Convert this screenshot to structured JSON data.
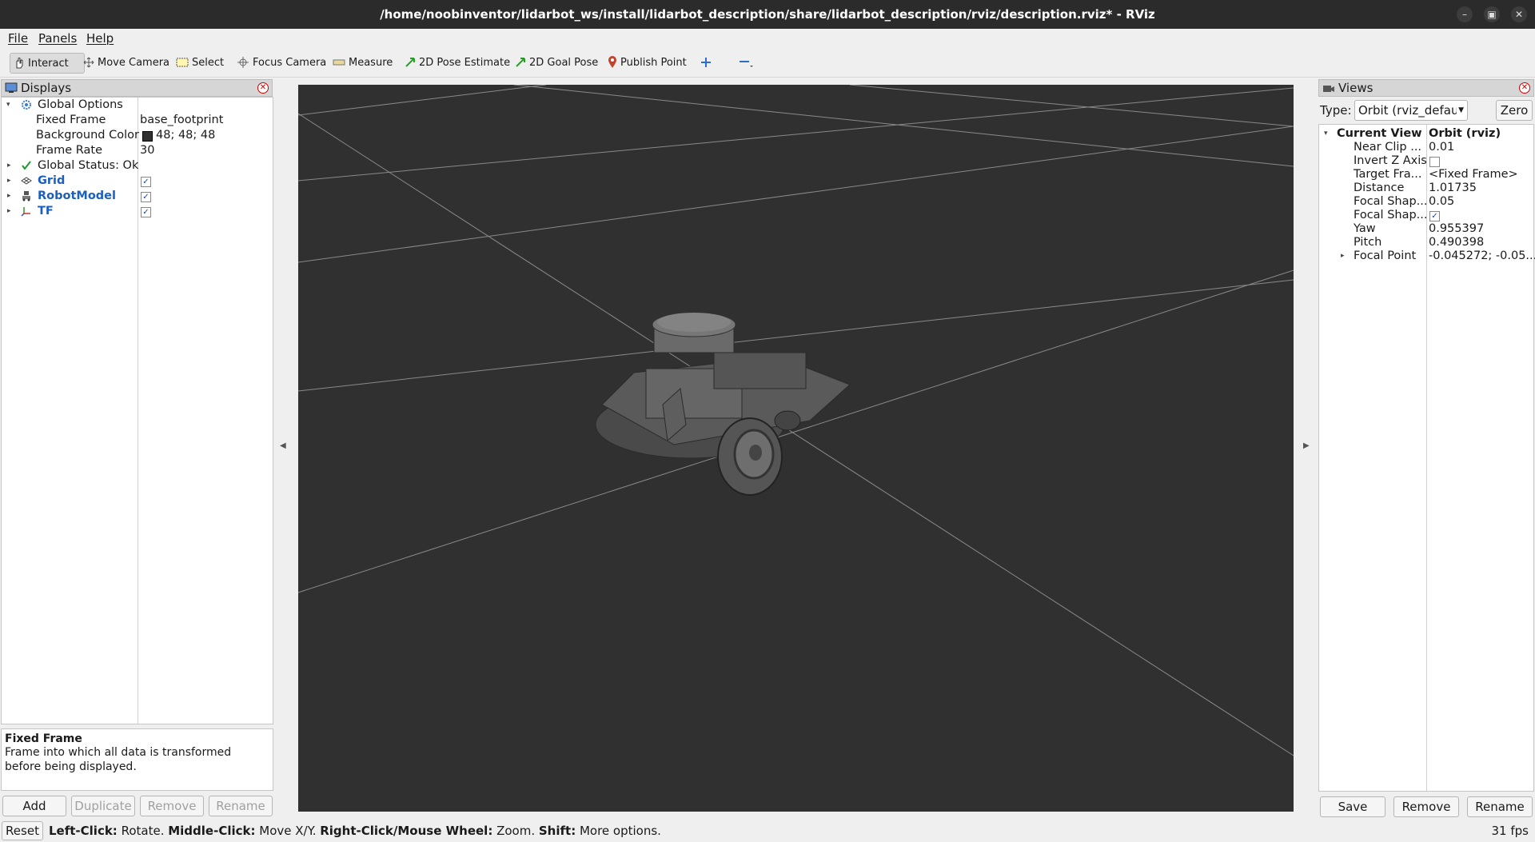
{
  "window": {
    "title": "/home/noobinventor/lidarbot_ws/install/lidarbot_description/share/lidarbot_description/rviz/description.rviz* - RViz"
  },
  "menu": [
    "File",
    "Panels",
    "Help"
  ],
  "toolbar": {
    "interact": "Interact",
    "move_camera": "Move Camera",
    "select": "Select",
    "focus_camera": "Focus Camera",
    "measure": "Measure",
    "pose_estimate": "2D Pose Estimate",
    "goal_pose": "2D Goal Pose",
    "publish_point": "Publish Point"
  },
  "displays": {
    "title": "Displays",
    "global_options": "Global Options",
    "fixed_frame_label": "Fixed Frame",
    "fixed_frame_value": "base_footprint",
    "bg_color_label": "Background Color",
    "bg_color_value": "48; 48; 48",
    "bg_color_swatch": "#303030",
    "frame_rate_label": "Frame Rate",
    "frame_rate_value": "30",
    "global_status": "Global Status: Ok",
    "grid": "Grid",
    "robot_model": "RobotModel",
    "tf": "TF",
    "desc_title": "Fixed Frame",
    "desc_text": "Frame into which all data is transformed before being displayed.",
    "buttons": {
      "add": "Add",
      "duplicate": "Duplicate",
      "remove": "Remove",
      "rename": "Rename"
    }
  },
  "views": {
    "title": "Views",
    "type_label": "Type:",
    "type_value": "Orbit (rviz_defau",
    "zero": "Zero",
    "current_view": "Current View",
    "current_view_value": "Orbit (rviz)",
    "props": [
      {
        "label": "Near Clip ...",
        "value": "0.01"
      },
      {
        "label": "Invert Z Axis",
        "value": ""
      },
      {
        "label": "Target Fra...",
        "value": "<Fixed Frame>"
      },
      {
        "label": "Distance",
        "value": "1.01735"
      },
      {
        "label": "Focal Shap...",
        "value": "0.05"
      },
      {
        "label": "Focal Shap...",
        "value": ""
      },
      {
        "label": "Yaw",
        "value": "0.955397"
      },
      {
        "label": "Pitch",
        "value": "0.490398"
      },
      {
        "label": "Focal Point",
        "value": "-0.045272; -0.05..."
      }
    ],
    "buttons": {
      "save": "Save",
      "remove": "Remove",
      "rename": "Rename"
    }
  },
  "status": {
    "reset": "Reset",
    "left_click": "Left-Click:",
    "left_click_text": " Rotate. ",
    "middle_click": "Middle-Click:",
    "middle_click_text": " Move X/Y. ",
    "right_click": "Right-Click/Mouse Wheel:",
    "right_click_text": " Zoom. ",
    "shift": "Shift:",
    "shift_text": " More options.",
    "fps": "31 fps"
  }
}
